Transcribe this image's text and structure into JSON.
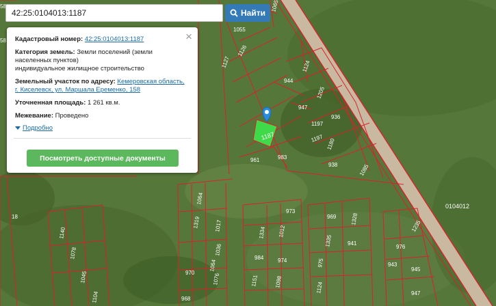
{
  "search": {
    "value": "42:25:0104013:1187",
    "button_label": "Найти"
  },
  "panel": {
    "cadastral_label": "Кадастровый номер:",
    "cadastral_value": "42:25:0104013:1187",
    "category_label": "Категория земель:",
    "category_value": "Земли поселений (земли населенных пунктов)",
    "usage_value": "индивидуальное жилищное строительство",
    "address_label": "Земельный участок по адресу:",
    "address_value": "Кемеровская область, г. Киселевск, ул. Маршала Еременко, 158",
    "area_label": "Уточненная площадь:",
    "area_value": "1 261 кв.м.",
    "survey_label": "Межевание:",
    "survey_value": "Проведено",
    "more_label": "Подробно",
    "docs_button": "Посмотреть доступные документы",
    "close_glyph": "×"
  },
  "map": {
    "quarter_label": "0104012",
    "selected_parcel": "1187",
    "parcels": [
      "1055",
      "1126",
      "1127",
      "944",
      "1124",
      "1205",
      "947",
      "936",
      "1197",
      "1197",
      "1180",
      "938",
      "1085",
      "961",
      "983",
      "1064",
      "1319",
      "1017",
      "1036",
      "973",
      "1334",
      "1012",
      "969",
      "1328",
      "984",
      "974",
      "1335",
      "941",
      "975",
      "976",
      "1078",
      "1140",
      "970",
      "1076",
      "1235",
      "1064",
      "943",
      "945",
      "968",
      "1045",
      "1151",
      "1098",
      "1124",
      "947",
      "1104",
      "18"
    ],
    "partial_labels": [
      "58",
      "58",
      "1065"
    ],
    "colors": {
      "boundary": "#d9222a",
      "selected_fill": "#3fd94a",
      "pin": "#2b8ce0",
      "road": "#c9b9a1"
    }
  }
}
